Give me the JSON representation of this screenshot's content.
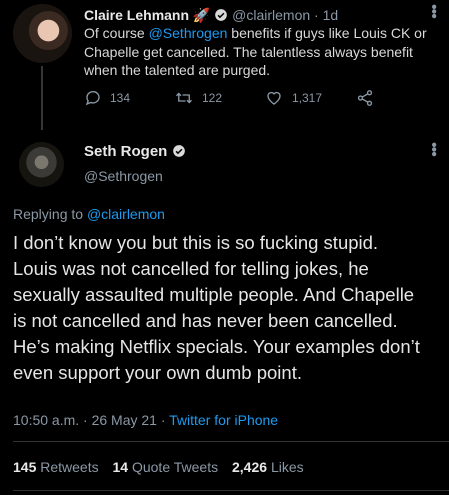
{
  "parent_tweet": {
    "name": "Claire Lehmann",
    "emoji": "🚀",
    "handle": "@clairlemon",
    "time": "1d",
    "text_before": "Of course ",
    "mention": "@Sethrogen",
    "text_after": " benefits if guys like Louis CK or Chapelle get cancelled. The talentless always benefit when the talented are purged.",
    "replies": "134",
    "retweets": "122",
    "likes": "1,317",
    "icons": [
      "reply-icon",
      "retweet-icon",
      "like-icon",
      "share-icon"
    ]
  },
  "main_tweet": {
    "name": "Seth Rogen",
    "handle": "@Sethrogen",
    "replying_prefix": "Replying to ",
    "replying_handle": "@clairlemon",
    "text": "I don’t know you but this is so fucking stupid. Louis was not cancelled for telling jokes, he sexually assaulted multiple people. And Chapelle is not cancelled and has never been cancelled. He’s making Netflix specials. Your examples don’t even support your own dumb point.",
    "time": "10:50 a.m. · 26 May 21 · ",
    "source": "Twitter for iPhone",
    "retweets_count": "145",
    "retweets_label": "Retweets",
    "quotes_count": "14",
    "quotes_label": "Quote Tweets",
    "likes_count": "2,426",
    "likes_label": "Likes"
  },
  "colors": {
    "background": "#000000",
    "link": "#1d9bf0",
    "muted": "#8b98a5",
    "text": "#e6e6e6"
  }
}
